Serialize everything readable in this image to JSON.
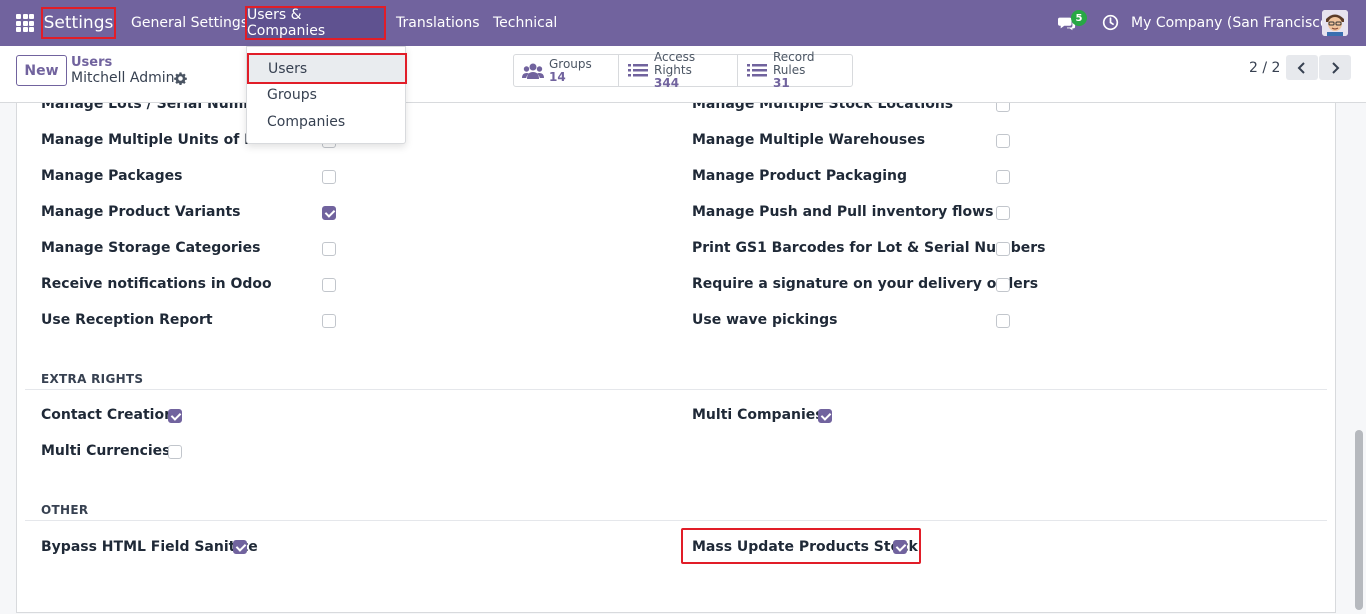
{
  "navbar": {
    "brand": "Settings",
    "menu": [
      "General Settings",
      "Users & Companies",
      "Translations",
      "Technical"
    ],
    "chat_count": "5",
    "company": "My Company (San Francisco)"
  },
  "dropdown": {
    "items": [
      "Users",
      "Groups",
      "Companies"
    ]
  },
  "control": {
    "new_label": "New",
    "breadcrumb_parent": "Users",
    "breadcrumb_current": "Mitchell Admin",
    "stats": [
      {
        "label": "Groups",
        "value": "14"
      },
      {
        "label": "Access Rights",
        "value": "344"
      },
      {
        "label": "Record Rules",
        "value": "31"
      }
    ],
    "pager": "2 / 2"
  },
  "top_rights": {
    "left": [
      {
        "label": "Manage Lots / Serial Numbers",
        "checked": false
      },
      {
        "label": "Manage Multiple Units of Measure",
        "checked": false
      },
      {
        "label": "Manage Packages",
        "checked": false
      },
      {
        "label": "Manage Product Variants",
        "checked": true
      },
      {
        "label": "Manage Storage Categories",
        "checked": false
      },
      {
        "label": "Receive notifications in Odoo",
        "checked": false
      },
      {
        "label": "Use Reception Report",
        "checked": false
      }
    ],
    "right": [
      {
        "label": "Manage Multiple Stock Locations",
        "checked": false
      },
      {
        "label": "Manage Multiple Warehouses",
        "checked": false
      },
      {
        "label": "Manage Product Packaging",
        "checked": false
      },
      {
        "label": "Manage Push and Pull inventory flows",
        "checked": false
      },
      {
        "label": "Print GS1 Barcodes for Lot & Serial Numbers",
        "checked": false
      },
      {
        "label": "Require a signature on your delivery orders",
        "checked": false
      },
      {
        "label": "Use wave pickings",
        "checked": false
      }
    ]
  },
  "extra_rights": {
    "title": "EXTRA RIGHTS",
    "items": [
      {
        "label": "Contact Creation",
        "checked": true
      },
      {
        "label": "Multi Companies",
        "checked": true
      },
      {
        "label": "Multi Currencies",
        "checked": false
      }
    ]
  },
  "other": {
    "title": "OTHER",
    "items": [
      {
        "label": "Bypass HTML Field Sanitize",
        "checked": true
      },
      {
        "label": "Mass Update Products Stock",
        "checked": true
      }
    ]
  },
  "colors": {
    "primary": "#71639e",
    "highlight": "#e11d28",
    "badge": "#28a745"
  }
}
